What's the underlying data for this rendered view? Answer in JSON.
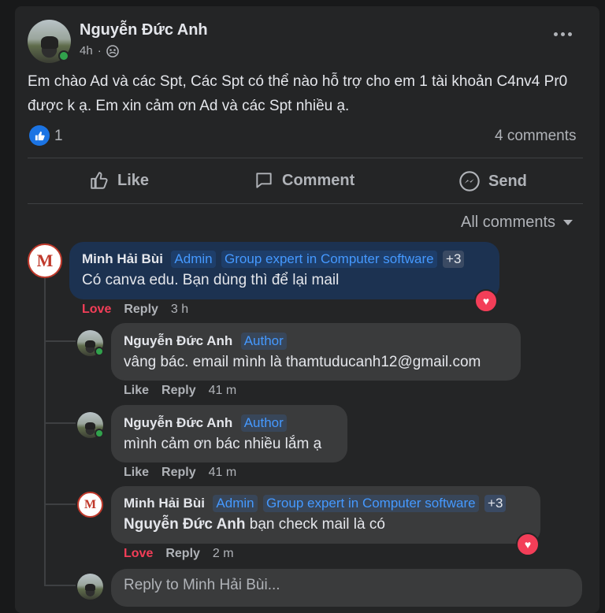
{
  "post": {
    "author": "Nguyễn Đức Anh",
    "time": "4h",
    "audience_icon": "group-audience-icon",
    "text": "Em chào Ad và các Spt, Các Spt có thể nào hỗ trợ cho em 1 tài khoản C4nv4 Pr0 được k ạ. Em xin cảm ơn Ad và các Spt nhiều ạ.",
    "reaction_count": "1",
    "comments_count": "4 comments",
    "actions": {
      "like": "Like",
      "comment": "Comment",
      "send": "Send"
    },
    "sort_label": "All comments"
  },
  "comments": [
    {
      "name": "Minh Hải Bùi",
      "badges": [
        "Admin",
        "Group expert in Computer software",
        "+3"
      ],
      "text": "Có canva edu. Bạn dùng thì để lại mail",
      "action1": "Love",
      "reply": "Reply",
      "time": "3 h"
    },
    {
      "name": "Nguyễn Đức Anh",
      "badge": "Author",
      "text": "vâng bác. email mình là thamtuducanh12@gmail.com",
      "action1": "Like",
      "reply": "Reply",
      "time": "41 m"
    },
    {
      "name": "Nguyễn Đức Anh",
      "badge": "Author",
      "text": "mình cảm ơn bác nhiều lắm ạ",
      "action1": "Like",
      "reply": "Reply",
      "time": "41 m"
    },
    {
      "name": "Minh Hải Bùi",
      "badges": [
        "Admin",
        "Group expert in Computer software",
        "+3"
      ],
      "mention": "Nguyễn Đức Anh",
      "text": " bạn check mail là có",
      "action1": "Love",
      "reply": "Reply",
      "time": "2 m"
    }
  ],
  "reply_placeholder": "Reply to Minh Hải Bùi...",
  "colors": {
    "card": "#242526",
    "bubble": "#3a3b3c",
    "highlight_bubble": "#1c3251",
    "link": "#4599ff",
    "love": "#f33e58",
    "online": "#31a24c"
  }
}
